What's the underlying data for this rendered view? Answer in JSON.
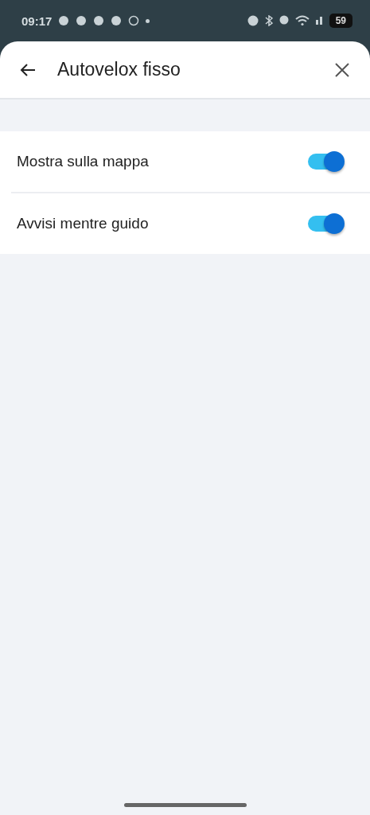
{
  "status_bar": {
    "time": "09:17",
    "battery": "59"
  },
  "header": {
    "title": "Autovelox fisso"
  },
  "settings": [
    {
      "label": "Mostra sulla mappa",
      "on": true
    },
    {
      "label": "Avvisi mentre guido",
      "on": true
    }
  ]
}
